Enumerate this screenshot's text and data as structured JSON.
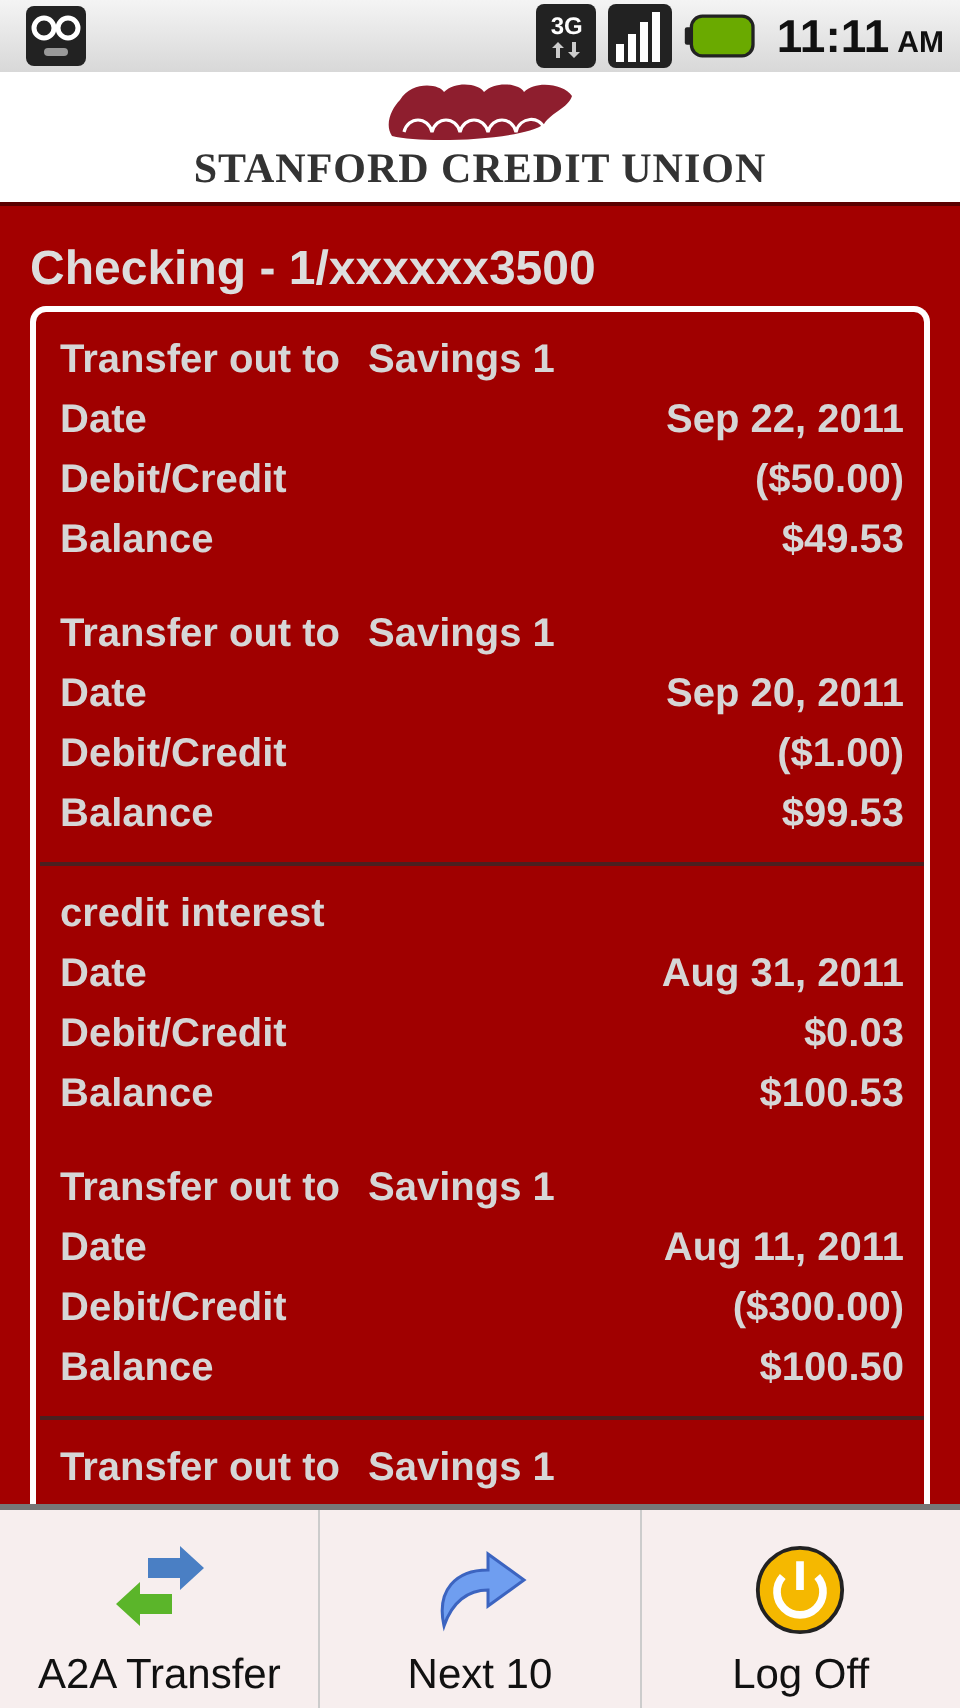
{
  "status_bar": {
    "network": "3G",
    "time": "11:11",
    "meridiem": "AM"
  },
  "header": {
    "logo_text": "STANFORD CREDIT UNION"
  },
  "account": {
    "title": "Checking - 1/xxxxxx3500"
  },
  "groups": [
    {
      "records": [
        {
          "description": "Transfer out to",
          "target": "Savings 1",
          "fields": [
            {
              "label": "Date",
              "value": "Sep 22, 2011"
            },
            {
              "label": "Debit/Credit",
              "value": "($50.00)"
            },
            {
              "label": "Balance",
              "value": "$49.53"
            }
          ]
        },
        {
          "description": "Transfer out to",
          "target": "Savings 1",
          "fields": [
            {
              "label": "Date",
              "value": "Sep 20, 2011"
            },
            {
              "label": "Debit/Credit",
              "value": "($1.00)"
            },
            {
              "label": "Balance",
              "value": "$99.53"
            }
          ]
        }
      ]
    },
    {
      "records": [
        {
          "description": "credit interest",
          "fields": [
            {
              "label": "Date",
              "value": "Aug 31, 2011"
            },
            {
              "label": "Debit/Credit",
              "value": "$0.03"
            },
            {
              "label": "Balance",
              "value": "$100.53"
            }
          ]
        },
        {
          "description": "Transfer out to",
          "target": "Savings 1",
          "fields": [
            {
              "label": "Date",
              "value": "Aug 11, 2011"
            },
            {
              "label": "Debit/Credit",
              "value": "($300.00)"
            },
            {
              "label": "Balance",
              "value": "$100.50"
            }
          ]
        }
      ]
    },
    {
      "records": [
        {
          "description": "Transfer out to",
          "target": "Savings 1"
        }
      ]
    }
  ],
  "menu": [
    {
      "kind": "transfer",
      "label": "A2A Transfer"
    },
    {
      "kind": "next",
      "label": "Next 10"
    },
    {
      "kind": "logoff",
      "label": "Log Off"
    }
  ]
}
